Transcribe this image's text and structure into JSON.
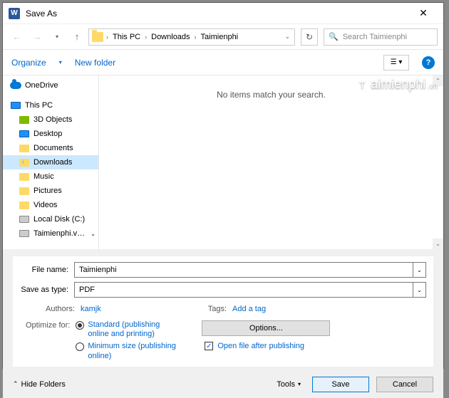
{
  "title": "Save As",
  "path": [
    "This PC",
    "Downloads",
    "Taimienphi"
  ],
  "search_placeholder": "Search Taimienphi",
  "toolbar": {
    "organize": "Organize",
    "new_folder": "New folder"
  },
  "sidebar": {
    "onedrive": "OneDrive",
    "thispc": "This PC",
    "items": [
      "3D Objects",
      "Desktop",
      "Documents",
      "Downloads",
      "Music",
      "Pictures",
      "Videos",
      "Local Disk (C:)",
      "Taimienphi.vn (D"
    ]
  },
  "empty_msg": "No items match your search.",
  "watermark": {
    "brand": "aimienphi",
    "suffix": ".vn"
  },
  "form": {
    "filename_label": "File name:",
    "filename_value": "Taimienphi",
    "savetype_label": "Save as type:",
    "savetype_value": "PDF",
    "authors_label": "Authors:",
    "authors_value": "kamjk",
    "tags_label": "Tags:",
    "tags_value": "Add a tag",
    "optimize_label": "Optimize for:",
    "optimize_standard": "Standard (publishing online and printing)",
    "optimize_minimum": "Minimum size (publishing online)",
    "options_btn": "Options...",
    "open_after": "Open file after publishing"
  },
  "footer": {
    "hide_folders": "Hide Folders",
    "tools": "Tools",
    "save": "Save",
    "cancel": "Cancel"
  }
}
